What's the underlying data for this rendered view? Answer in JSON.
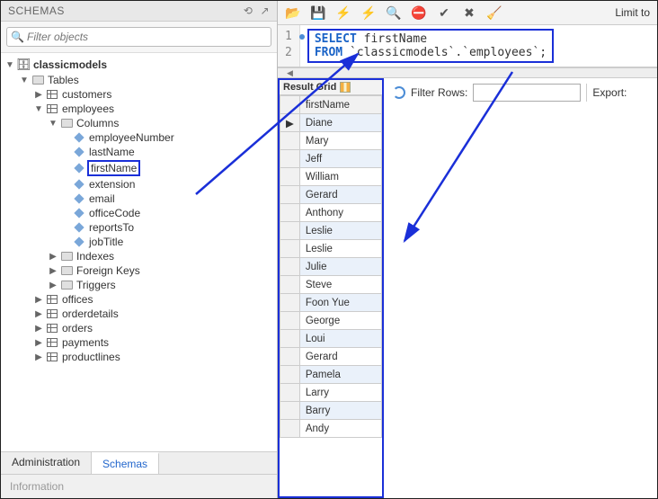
{
  "left": {
    "title": "SCHEMAS",
    "filter_placeholder": "Filter objects",
    "database": "classicmodels",
    "tables_label": "Tables",
    "tables": [
      "customers",
      "employees",
      "offices",
      "orderdetails",
      "orders",
      "payments",
      "productlines"
    ],
    "employees": {
      "columns_label": "Columns",
      "columns": [
        "employeeNumber",
        "lastName",
        "firstName",
        "extension",
        "email",
        "officeCode",
        "reportsTo",
        "jobTitle"
      ],
      "sections": [
        "Indexes",
        "Foreign Keys",
        "Triggers"
      ]
    },
    "tabs": {
      "admin": "Administration",
      "schemas": "Schemas"
    },
    "info_label": "Information"
  },
  "right": {
    "limit_label": "Limit to",
    "sql": {
      "line1_kw": "SELECT",
      "line1_col": "firstName",
      "line2_kw": "FROM",
      "line2_rest": "`classicmodels`.`employees`;"
    },
    "result_tab": "Result Grid",
    "grid_header": "firstName",
    "rows": [
      "Diane",
      "Mary",
      "Jeff",
      "William",
      "Gerard",
      "Anthony",
      "Leslie",
      "Leslie",
      "Julie",
      "Steve",
      "Foon Yue",
      "George",
      "Loui",
      "Gerard",
      "Pamela",
      "Larry",
      "Barry",
      "Andy"
    ],
    "filter_label": "Filter Rows:",
    "export_label": "Export:"
  }
}
